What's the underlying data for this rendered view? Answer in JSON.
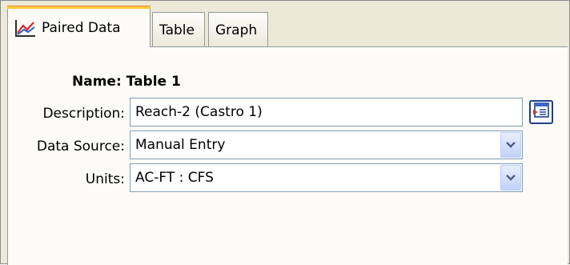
{
  "tabs": [
    {
      "label": "Paired Data",
      "icon": "paired-data-chart-icon",
      "active": true
    },
    {
      "label": "Table",
      "active": false
    },
    {
      "label": "Graph",
      "active": false
    }
  ],
  "form": {
    "name_label": "Name:",
    "name_value": "Table 1",
    "description_label": "Description:",
    "description_value": "Reach-2 (Castro 1)",
    "data_source_label": "Data Source:",
    "data_source_value": "Manual Entry",
    "units_label": "Units:",
    "units_value": "AC-FT : CFS"
  },
  "icons": {
    "description_editor": "text-editor-icon",
    "dropdown": "chevron-down-icon"
  },
  "colors": {
    "panel_bg": "#ece9d8",
    "content_bg": "#fcfbf7",
    "active_tab_accent": "#ffc83c",
    "input_border": "#7f9db9"
  }
}
